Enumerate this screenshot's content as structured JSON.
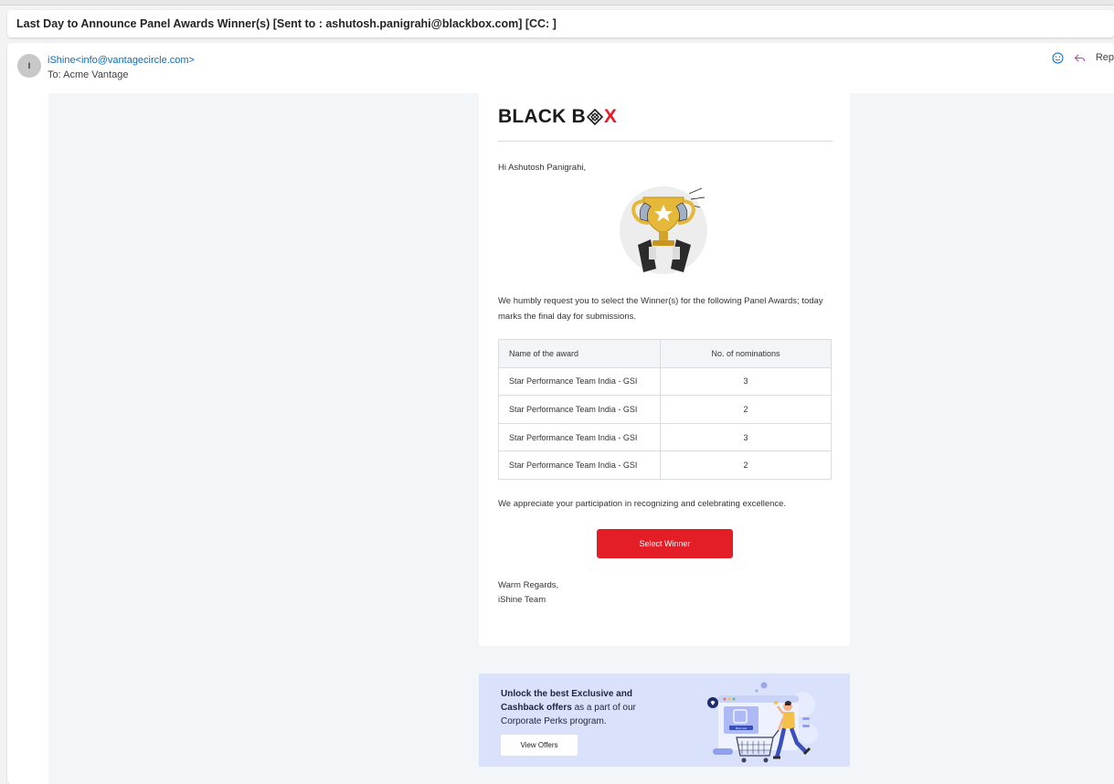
{
  "subject": "Last Day to Announce Panel Awards Winner(s) [Sent to : ashutosh.panigrahi@blackbox.com] [CC: ]",
  "header": {
    "avatar_initial": "I",
    "sender": "iShine<info@vantagecircle.com>",
    "to": "To:  Acme Vantage",
    "reply_label": "Rep"
  },
  "email": {
    "logo_left": "BLACK B",
    "logo_right": "X",
    "greeting": "Hi Ashutosh Panigrahi,",
    "request": "We humbly request you to select the Winner(s) for the following Panel Awards; today marks the final day for submissions.",
    "table": {
      "headers": [
        "Name of the award",
        "No. of nominations"
      ],
      "rows": [
        [
          "Star Performance Team India - GSI",
          "3"
        ],
        [
          "Star Performance Team India - GSI",
          "2"
        ],
        [
          "Star Performance Team India - GSI",
          "3"
        ],
        [
          "Star Performance Team India - GSI",
          "2"
        ]
      ]
    },
    "appreciate": "We appreciate your participation in recognizing and celebrating excellence.",
    "cta": "Select Winner",
    "regards_1": "Warm Regards,",
    "regards_2": "iShine Team"
  },
  "promo": {
    "bold_1": "Unlock the best Exclusive and",
    "bold_2": "Cashback offers",
    "normal_2": " as a part of our",
    "line_3": "Corporate Perks program.",
    "button": "View Offers",
    "art_shop_label": "Shop now"
  },
  "colors": {
    "brand_red": "#e31e26",
    "link_blue": "#0f6cbd",
    "promo_bg": "#d9e1fb"
  }
}
